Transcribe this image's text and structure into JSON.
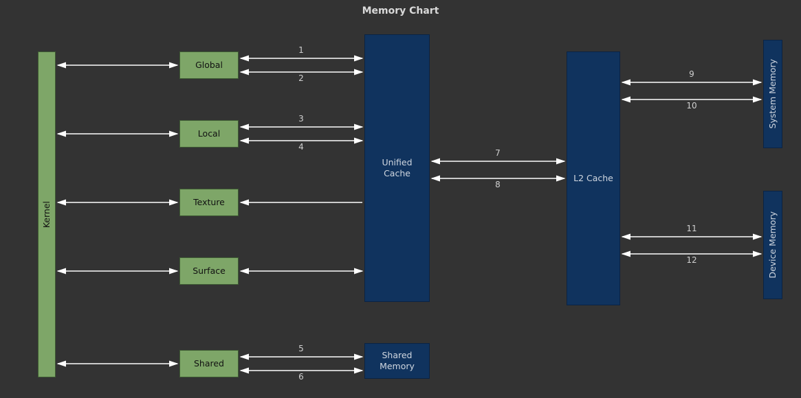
{
  "title": "Memory Chart",
  "nodes": {
    "kernel": "Kernel",
    "global": "Global",
    "local": "Local",
    "texture": "Texture",
    "surface": "Surface",
    "shared": "Shared",
    "unified_cache": "Unified Cache",
    "shared_memory": "Shared Memory",
    "l2_cache": "L2 Cache",
    "system_memory": "System Memory",
    "device_memory": "Device Memory"
  },
  "edge_labels": {
    "e1": "1",
    "e2": "2",
    "e3": "3",
    "e4": "4",
    "e5": "5",
    "e6": "6",
    "e7": "7",
    "e8": "8",
    "e9": "9",
    "e10": "10",
    "e11": "11",
    "e12": "12"
  },
  "colors": {
    "bg": "#333333",
    "green": "#7ea668",
    "blue": "#10335e",
    "arrow": "#ffffff"
  }
}
